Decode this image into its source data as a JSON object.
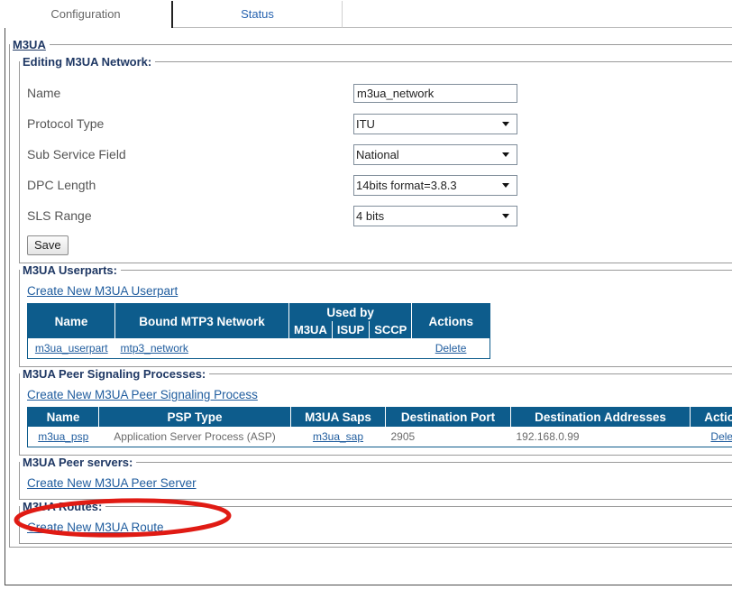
{
  "tabs": [
    {
      "label": "Configuration",
      "active": true
    },
    {
      "label": "Status",
      "active": false
    }
  ],
  "sections": {
    "m3ua": {
      "legend": "M3UA"
    },
    "editing": {
      "legend": "Editing M3UA Network:",
      "fields": [
        {
          "label": "Name",
          "type": "text",
          "value": "m3ua_network"
        },
        {
          "label": "Protocol Type",
          "type": "select",
          "value": "ITU"
        },
        {
          "label": "Sub Service Field",
          "type": "select",
          "value": "National"
        },
        {
          "label": "DPC Length",
          "type": "select",
          "value": "14bits format=3.8.3"
        },
        {
          "label": "SLS Range",
          "type": "select",
          "value": "4 bits"
        }
      ],
      "save_label": "Save"
    },
    "userparts": {
      "legend": "M3UA Userparts:",
      "create_link": "Create New M3UA Userpart",
      "headers": {
        "name": "Name",
        "bound": "Bound MTP3 Network",
        "used_by": "Used by",
        "used_m3ua": "M3UA",
        "used_isup": "ISUP",
        "used_sccp": "SCCP",
        "actions": "Actions"
      },
      "rows": [
        {
          "name": "m3ua_userpart",
          "bound": "mtp3_network",
          "used_m3ua": "",
          "used_isup": "",
          "used_sccp": "",
          "action": "Delete"
        }
      ]
    },
    "psp": {
      "legend": "M3UA Peer Signaling Processes:",
      "create_link": "Create New M3UA Peer Signaling Process",
      "headers": {
        "name": "Name",
        "type": "PSP Type",
        "saps": "M3UA Saps",
        "port": "Destination Port",
        "addresses": "Destination Addresses",
        "actions": "Actions"
      },
      "rows": [
        {
          "name": "m3ua_psp",
          "type": "Application Server Process (ASP)",
          "saps": "m3ua_sap",
          "port": "2905",
          "addresses": "192.168.0.99",
          "action": "Delete"
        }
      ]
    },
    "peer_servers": {
      "legend": "M3UA Peer servers:",
      "create_link": "Create New M3UA Peer Server"
    },
    "routes": {
      "legend": "M3UA Routes:",
      "create_link": "Create New M3UA Route"
    }
  },
  "annotation": {
    "shape": "ellipse",
    "color": "#e01b14",
    "target": "Create New M3UA Peer Server"
  },
  "colors": {
    "table_header_bg": "#0d5c8c",
    "link": "#1f5c9e",
    "legend": "#1f3864",
    "annotation": "#e01b14"
  }
}
